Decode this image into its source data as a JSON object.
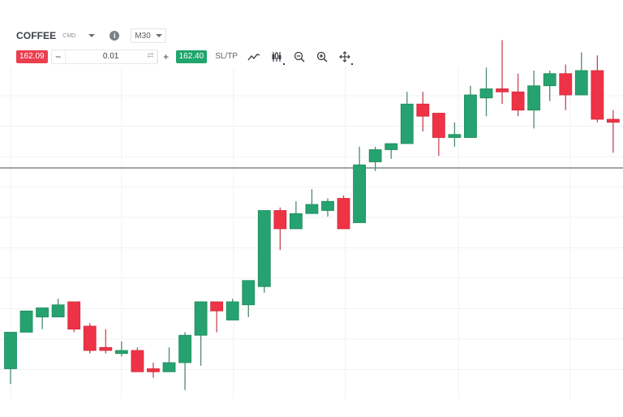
{
  "header": {
    "symbol": "COFFEE",
    "symbol_type": "CMD",
    "info_icon": "info-icon",
    "timeframe": "M30"
  },
  "trade": {
    "sell_price": "162.09",
    "quantity": "0.01",
    "buy_price": "162.40",
    "sltp_label": "SL/TP",
    "decrease_label": "−",
    "increase_label": "+"
  },
  "toolbar": {
    "icons": [
      "line-chart-icon",
      "candlestick-icon",
      "zoom-out-icon",
      "zoom-in-icon",
      "crosshair-icon"
    ]
  },
  "colors": {
    "up": "#26a270",
    "down": "#ee3347",
    "sell": "#ea3f4f",
    "buy": "#1fa56d",
    "price_line": "#7f8b87",
    "grid": "#f0f1f3"
  },
  "chart_data": {
    "type": "candlestick",
    "title": "COFFEE CMD M30",
    "xlabel": "",
    "ylabel": "",
    "grid": true,
    "current_price_line": 162.25,
    "ylim": [
      161.25,
      162.62
    ],
    "candles": [
      {
        "o": 161.59,
        "h": 161.67,
        "l": 161.54,
        "c": 161.71
      },
      {
        "o": 161.71,
        "h": 161.75,
        "l": 161.71,
        "c": 161.78
      },
      {
        "o": 161.76,
        "h": 161.77,
        "l": 161.72,
        "c": 161.79
      },
      {
        "o": 161.76,
        "h": 161.82,
        "l": 161.76,
        "c": 161.8
      },
      {
        "o": 161.81,
        "h": 161.81,
        "l": 161.71,
        "c": 161.72
      },
      {
        "o": 161.73,
        "h": 161.74,
        "l": 161.64,
        "c": 161.65
      },
      {
        "o": 161.66,
        "h": 161.72,
        "l": 161.64,
        "c": 161.65
      },
      {
        "o": 161.64,
        "h": 161.68,
        "l": 161.63,
        "c": 161.65
      },
      {
        "o": 161.65,
        "h": 161.66,
        "l": 161.58,
        "c": 161.58
      },
      {
        "o": 161.59,
        "h": 161.61,
        "l": 161.56,
        "c": 161.58
      },
      {
        "o": 161.58,
        "h": 161.66,
        "l": 161.58,
        "c": 161.61
      },
      {
        "o": 161.61,
        "h": 161.71,
        "l": 161.52,
        "c": 161.7
      },
      {
        "o": 161.7,
        "h": 161.81,
        "l": 161.6,
        "c": 161.81
      },
      {
        "o": 161.81,
        "h": 161.81,
        "l": 161.71,
        "c": 161.78
      },
      {
        "o": 161.75,
        "h": 161.82,
        "l": 161.75,
        "c": 161.81
      },
      {
        "o": 161.8,
        "h": 161.86,
        "l": 161.76,
        "c": 161.88
      },
      {
        "o": 161.86,
        "h": 162.11,
        "l": 161.84,
        "c": 162.11
      },
      {
        "o": 162.11,
        "h": 162.12,
        "l": 161.98,
        "c": 162.05
      },
      {
        "o": 162.05,
        "h": 162.14,
        "l": 162.05,
        "c": 162.1
      },
      {
        "o": 162.1,
        "h": 162.18,
        "l": 162.1,
        "c": 162.13
      },
      {
        "o": 162.11,
        "h": 162.15,
        "l": 162.09,
        "c": 162.14
      },
      {
        "o": 162.15,
        "h": 162.16,
        "l": 162.05,
        "c": 162.05
      },
      {
        "o": 162.07,
        "h": 162.32,
        "l": 162.07,
        "c": 162.26
      },
      {
        "o": 162.27,
        "h": 162.32,
        "l": 162.24,
        "c": 162.31
      },
      {
        "o": 162.31,
        "h": 162.33,
        "l": 162.28,
        "c": 162.33
      },
      {
        "o": 162.33,
        "h": 162.5,
        "l": 162.33,
        "c": 162.46
      },
      {
        "o": 162.46,
        "h": 162.5,
        "l": 162.37,
        "c": 162.42
      },
      {
        "o": 162.43,
        "h": 162.43,
        "l": 162.29,
        "c": 162.35
      },
      {
        "o": 162.35,
        "h": 162.4,
        "l": 162.32,
        "c": 162.36
      },
      {
        "o": 162.35,
        "h": 162.52,
        "l": 162.35,
        "c": 162.49
      },
      {
        "o": 162.48,
        "h": 162.58,
        "l": 162.42,
        "c": 162.51
      },
      {
        "o": 162.51,
        "h": 162.67,
        "l": 162.46,
        "c": 162.5
      },
      {
        "o": 162.5,
        "h": 162.56,
        "l": 162.42,
        "c": 162.44
      },
      {
        "o": 162.44,
        "h": 162.57,
        "l": 162.38,
        "c": 162.52
      },
      {
        "o": 162.52,
        "h": 162.57,
        "l": 162.47,
        "c": 162.56
      },
      {
        "o": 162.56,
        "h": 162.59,
        "l": 162.44,
        "c": 162.49
      },
      {
        "o": 162.49,
        "h": 162.63,
        "l": 162.49,
        "c": 162.57
      },
      {
        "o": 162.57,
        "h": 162.62,
        "l": 162.4,
        "c": 162.41
      },
      {
        "o": 162.41,
        "h": 162.44,
        "l": 162.3,
        "c": 162.4
      }
    ]
  }
}
